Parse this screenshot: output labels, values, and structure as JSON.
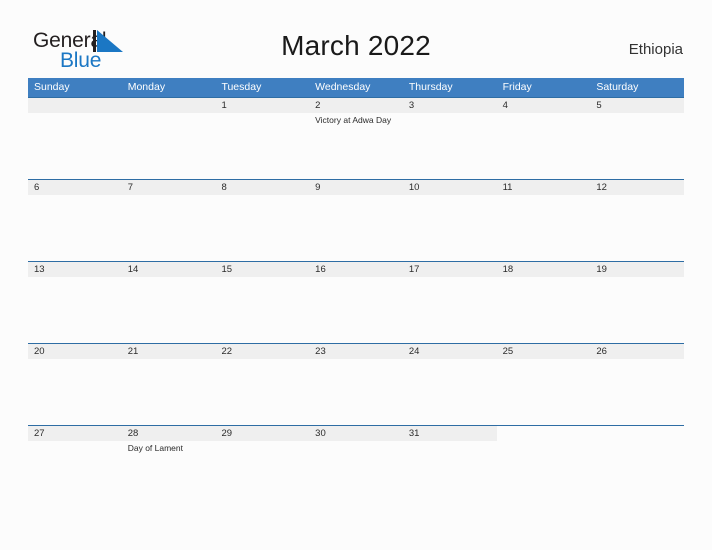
{
  "brand": {
    "name_part1": "General",
    "name_part2": "Blue",
    "logo_icon": "triangle-flag-icon"
  },
  "header": {
    "title": "March 2022",
    "country": "Ethiopia"
  },
  "calendar": {
    "day_headers": [
      "Sunday",
      "Monday",
      "Tuesday",
      "Wednesday",
      "Thursday",
      "Friday",
      "Saturday"
    ],
    "colors": {
      "header_blue": "#3f7fc1",
      "separator_blue": "#2e6da4",
      "date_band_gray": "#efefef",
      "brand_blue": "#1b77c4",
      "text_dark": "#2b2b2b",
      "page_background": "#fcfcfc"
    },
    "weeks": [
      {
        "dates": [
          "",
          "",
          "1",
          "2",
          "3",
          "4",
          "5"
        ],
        "events": [
          "",
          "",
          "",
          "Victory at Adwa Day",
          "",
          "",
          ""
        ]
      },
      {
        "dates": [
          "6",
          "7",
          "8",
          "9",
          "10",
          "11",
          "12"
        ],
        "events": [
          "",
          "",
          "",
          "",
          "",
          "",
          ""
        ]
      },
      {
        "dates": [
          "13",
          "14",
          "15",
          "16",
          "17",
          "18",
          "19"
        ],
        "events": [
          "",
          "",
          "",
          "",
          "",
          "",
          ""
        ]
      },
      {
        "dates": [
          "20",
          "21",
          "22",
          "23",
          "24",
          "25",
          "26"
        ],
        "events": [
          "",
          "",
          "",
          "",
          "",
          "",
          ""
        ]
      },
      {
        "dates": [
          "27",
          "28",
          "29",
          "30",
          "31",
          "",
          ""
        ],
        "events": [
          "",
          "Day of Lament",
          "",
          "",
          "",
          "",
          ""
        ]
      }
    ]
  }
}
